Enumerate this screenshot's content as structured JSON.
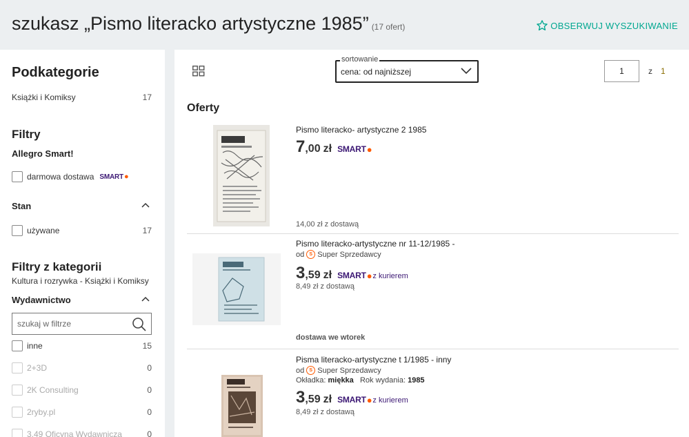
{
  "header": {
    "query_prefix": "szukasz „Pismo literacko artystyczne 1985”",
    "offers_count": "(17 ofert)",
    "follow_label": "OBSERWUJ WYSZUKIWANIE"
  },
  "sidebar": {
    "subcategories_title": "Podkategorie",
    "subcategories": [
      {
        "label": "Książki i Komiksy",
        "count": "17"
      }
    ],
    "filters_title": "Filtry",
    "smart_title": "Allegro Smart!",
    "free_delivery": "darmowa dostawa",
    "smart_badge": "SMART",
    "condition_title": "Stan",
    "condition_items": [
      {
        "label": "używane",
        "count": "17"
      }
    ],
    "cat_filters_title": "Filtry z kategorii",
    "cat_path": "Kultura i rozrywka - Książki i Komiksy",
    "publisher_title": "Wydawnictwo",
    "filter_search_placeholder": "szukaj w filtrze",
    "publishers": [
      {
        "label": "inne",
        "count": "15"
      },
      {
        "label": "2+3D",
        "count": "0"
      },
      {
        "label": "2K Consulting",
        "count": "0"
      },
      {
        "label": "2ryby.pl",
        "count": "0"
      },
      {
        "label": "3.49 Oficyna Wydawnicza",
        "count": "0"
      }
    ]
  },
  "toolbar": {
    "sort_legend": "sortowanie",
    "sort_value": "cena: od najniższej",
    "page_current": "1",
    "page_of": "z",
    "page_total": "1"
  },
  "offers_title": "Oferty",
  "offers": [
    {
      "title": "Pismo literacko- artystyczne 2 1985",
      "price_int": "7",
      "price_dec": ",00",
      "currency": "zł",
      "smart": "SMART",
      "shipping": "14,00 zł z dostawą"
    },
    {
      "title": "Pismo literacko-artystyczne nr 11-12/1985 -",
      "seller_prefix": "od",
      "seller": "Super Sprzedawcy",
      "price_int": "3",
      "price_dec": ",59",
      "currency": "zł",
      "smart": "SMART",
      "courier": "z kurierem",
      "shipping": "8,49 zł z dostawą",
      "delivery": "dostawa we wtorek"
    },
    {
      "title": "Pisma literacko-artystyczne t 1/1985 - inny",
      "seller_prefix": "od",
      "seller": "Super Sprzedawcy",
      "param1_label": "Okładka:",
      "param1_value": "miękka",
      "param2_label": "Rok wydania:",
      "param2_value": "1985",
      "price_int": "3",
      "price_dec": ",59",
      "currency": "zł",
      "smart": "SMART",
      "courier": "z kurierem",
      "shipping": "8,49 zł z dostawą"
    }
  ],
  "colors": {
    "accent": "#00a790",
    "smart_purple": "#3c1874",
    "smart_orange": "#ff5a00",
    "page_bg": "#eceff1"
  }
}
